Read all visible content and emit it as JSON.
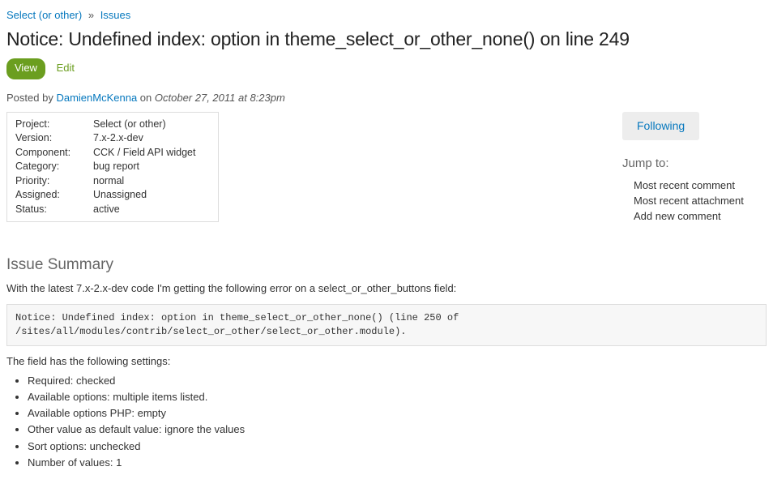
{
  "breadcrumb": {
    "project": "Select (or other)",
    "separator": "»",
    "section": "Issues"
  },
  "title": "Notice: Undefined index: option in theme_select_or_other_none() on line 249",
  "tabs": {
    "view": "View",
    "edit": "Edit"
  },
  "byline": {
    "posted_by": "Posted by",
    "author": "DamienMcKenna",
    "on": "on",
    "date": "October 27, 2011 at 8:23pm"
  },
  "meta": {
    "labels": {
      "project": "Project:",
      "version": "Version:",
      "component": "Component:",
      "category": "Category:",
      "priority": "Priority:",
      "assigned": "Assigned:",
      "status": "Status:"
    },
    "values": {
      "project": "Select (or other)",
      "version": "7.x-2.x-dev",
      "component": "CCK / Field API widget",
      "category": "bug report",
      "priority": "normal",
      "assigned": "Unassigned",
      "status": "active"
    }
  },
  "right": {
    "following": "Following",
    "jump_to": "Jump to:",
    "links": {
      "recent_comment": "Most recent comment",
      "recent_attachment": "Most recent attachment",
      "add_comment": "Add new comment"
    }
  },
  "summary": {
    "heading": "Issue Summary",
    "intro": "With the latest 7.x-2.x-dev code I'm getting the following error on a select_or_other_buttons field:",
    "code": "Notice: Undefined index: option in theme_select_or_other_none() (line 250 of\n/sites/all/modules/contrib/select_or_other/select_or_other.module).",
    "settings_head": "The field has the following settings:",
    "settings": {
      "s0": "Required: checked",
      "s1": "Available options: multiple items listed.",
      "s2": "Available options PHP: empty",
      "s3": "Other value as default value: ignore the values",
      "s4": "Sort options: unchecked",
      "s5": "Number of values: 1"
    }
  }
}
